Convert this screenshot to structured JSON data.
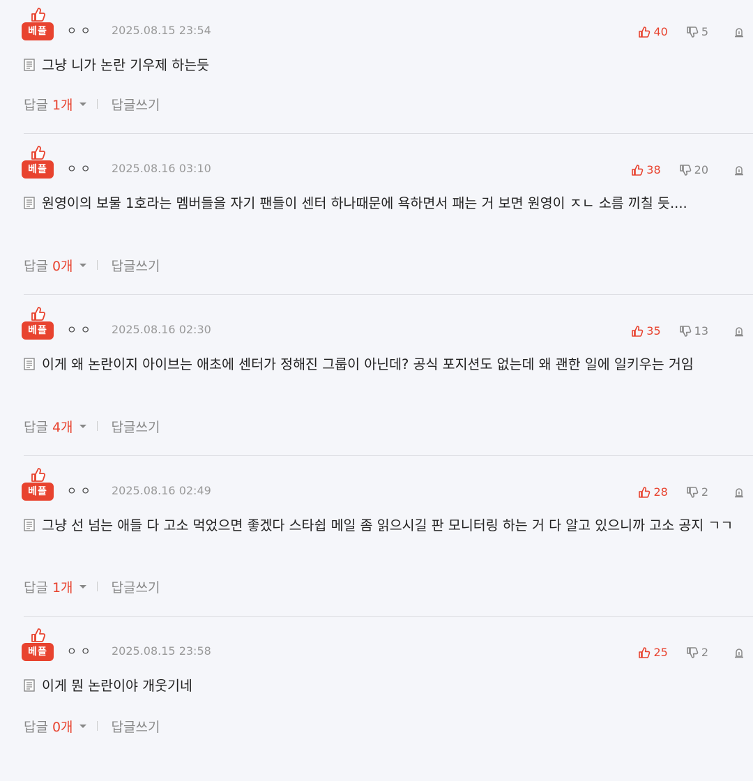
{
  "colors": {
    "accent": "#e8432f",
    "muted": "#999999",
    "divider": "#dcdde2"
  },
  "icons": {
    "badge_thumb": "thumbs-up-icon",
    "like": "thumbs-up-outline-icon",
    "dislike": "thumbs-down-outline-icon",
    "report": "siren-icon",
    "doc": "document-icon",
    "caret": "caret-down-icon"
  },
  "comments": [
    {
      "badge": "베플",
      "author": "ㅇㅇ",
      "date": "2025.08.15 23:54",
      "likes": "40",
      "dislikes": "5",
      "text": "그냥 니가 논란 기우제 하는듯",
      "reply_label": "답글",
      "reply_count": "1개",
      "write_reply": "답글쓰기"
    },
    {
      "badge": "베플",
      "author": "ㅇㅇ",
      "date": "2025.08.16 03:10",
      "likes": "38",
      "dislikes": "20",
      "text": "원영이의 보물 1호라는 멤버들을 자기 팬들이 센터 하나때문에 욕하면서 패는 거 보면 원영이 ㅈㄴ 소름 끼칠 듯....",
      "reply_label": "답글",
      "reply_count": "0개",
      "write_reply": "답글쓰기"
    },
    {
      "badge": "베플",
      "author": "ㅇㅇ",
      "date": "2025.08.16 02:30",
      "likes": "35",
      "dislikes": "13",
      "text": "이게 왜 논란이지 아이브는 애초에 센터가 정해진 그룹이 아닌데? 공식 포지션도 없는데 왜 괜한 일에 일키우는 거임",
      "reply_label": "답글",
      "reply_count": "4개",
      "write_reply": "답글쓰기"
    },
    {
      "badge": "베플",
      "author": "ㅇㅇ",
      "date": "2025.08.16 02:49",
      "likes": "28",
      "dislikes": "2",
      "text": "그냥 선 넘는 애들 다 고소 먹었으면 좋겠다 스타쉽 메일 좀 읽으시길 판 모니터링 하는 거 다 알고 있으니까 고소 공지 ㄱㄱ",
      "reply_label": "답글",
      "reply_count": "1개",
      "write_reply": "답글쓰기"
    },
    {
      "badge": "베플",
      "author": "ㅇㅇ",
      "date": "2025.08.15 23:58",
      "likes": "25",
      "dislikes": "2",
      "text": "이게 뭔 논란이야 개웃기네",
      "reply_label": "답글",
      "reply_count": "0개",
      "write_reply": "답글쓰기"
    }
  ]
}
